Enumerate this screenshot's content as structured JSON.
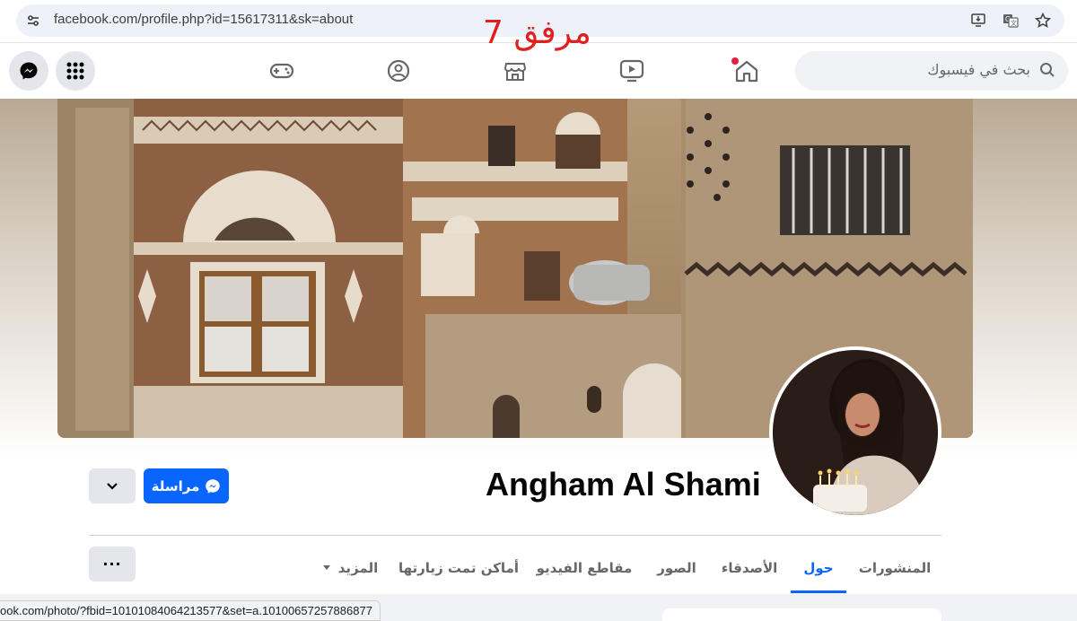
{
  "browser": {
    "url": "facebook.com/profile.php?id=15617311&sk=about",
    "status_url": "ook.com/photo/?fbid=10101084064213577&set=a.10100657257886877"
  },
  "overlay": {
    "label": "مرفق 7",
    "color": "#e02020"
  },
  "nav": {
    "search_placeholder": "بحث في فيسبوك",
    "icons": [
      "menu-grid-icon",
      "messenger-icon",
      "gaming-icon",
      "groups-icon",
      "marketplace-icon",
      "video-icon",
      "home-icon",
      "search-icon"
    ]
  },
  "profile": {
    "name": "Angham Al Shami",
    "message_button": "مراسلة",
    "more_button": "···"
  },
  "tabs": [
    {
      "label": "المنشورات",
      "active": false
    },
    {
      "label": "حول",
      "active": true
    },
    {
      "label": "الأصدقاء",
      "active": false
    },
    {
      "label": "الصور",
      "active": false
    },
    {
      "label": "مقاطع الفيديو",
      "active": false
    },
    {
      "label": "أماكن تمت زيارتها",
      "active": false
    },
    {
      "label": "المزيد",
      "active": false
    }
  ],
  "colors": {
    "accent": "#0866ff",
    "notification": "#e41e3f"
  }
}
